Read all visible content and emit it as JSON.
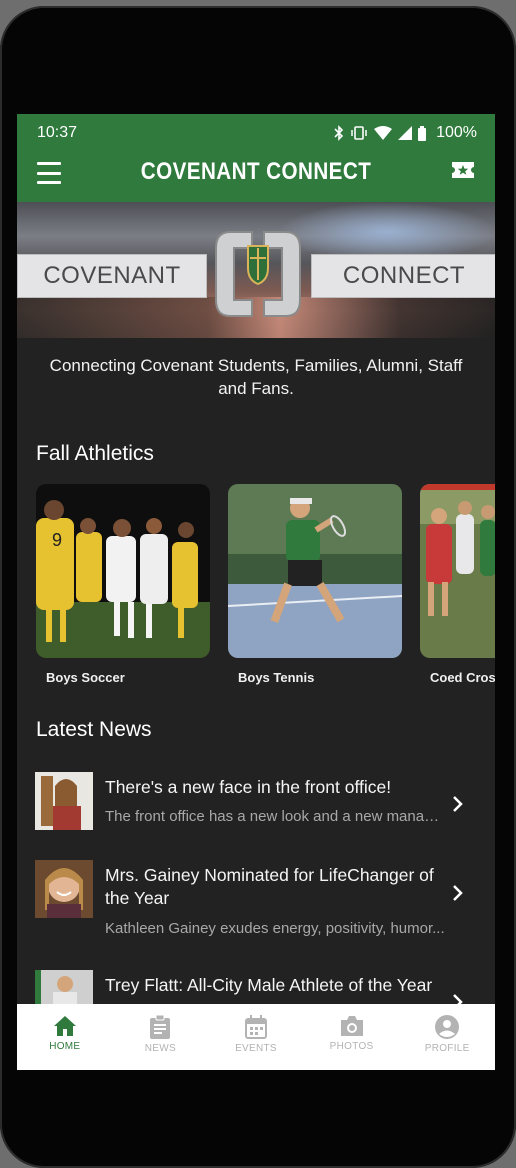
{
  "status_bar": {
    "time": "10:37",
    "battery": "100%"
  },
  "toolbar": {
    "title": "COVENANT CONNECT",
    "menu_icon": "menu-icon",
    "action_icon": "ticket-icon"
  },
  "banner": {
    "left_text": "COVENANT",
    "right_text": "CONNECT",
    "logo_text": "CC"
  },
  "tagline": "Connecting Covenant Students, Families, Alumni, Staff and Fans.",
  "fall_athletics": {
    "title": "Fall Athletics",
    "cards": [
      {
        "label": "Boys Soccer"
      },
      {
        "label": "Boys Tennis"
      },
      {
        "label": "Coed Cross"
      }
    ]
  },
  "latest_news": {
    "title": "Latest News",
    "items": [
      {
        "title": "There's a new face in the front office!",
        "summary": "The front office has a new look and a new manager..."
      },
      {
        "title": "Mrs. Gainey Nominated for LifeChanger of the Year",
        "summary": "Kathleen Gainey exudes energy, positivity, humor..."
      },
      {
        "title": "Trey Flatt: All-City Male Athlete of the Year",
        "summary": ""
      }
    ]
  },
  "bottom_nav": {
    "items": [
      {
        "label": "HOME",
        "icon": "home-icon",
        "active": true
      },
      {
        "label": "NEWS",
        "icon": "clipboard-icon",
        "active": false
      },
      {
        "label": "EVENTS",
        "icon": "calendar-icon",
        "active": false
      },
      {
        "label": "PHOTOS",
        "icon": "camera-icon",
        "active": false
      },
      {
        "label": "PROFILE",
        "icon": "profile-icon",
        "active": false
      }
    ]
  },
  "colors": {
    "brand_green": "#2f7a3c",
    "background": "#222222",
    "inactive_nav": "#b3b3b3"
  }
}
